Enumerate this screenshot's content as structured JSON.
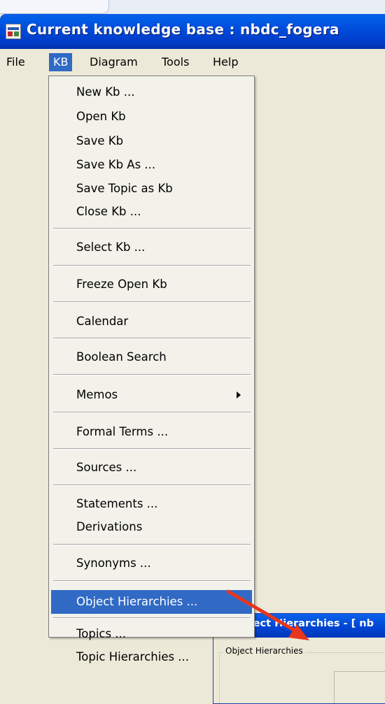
{
  "window": {
    "title": "Current knowledge base : nbdc_fogera"
  },
  "menubar": {
    "items": [
      "File",
      "KB",
      "Diagram",
      "Tools",
      "Help"
    ],
    "active": "KB"
  },
  "kb_menu": {
    "items": [
      {
        "label": "New Kb ...",
        "highlighted": false,
        "submenu": false
      },
      {
        "label": "Open Kb",
        "highlighted": false,
        "submenu": false
      },
      {
        "label": "Save Kb",
        "highlighted": false,
        "submenu": false
      },
      {
        "label": "Save Kb As ...",
        "highlighted": false,
        "submenu": false
      },
      {
        "label": "Save Topic as Kb",
        "highlighted": false,
        "submenu": false
      },
      {
        "label": "Close Kb ...",
        "highlighted": false,
        "submenu": false
      },
      {
        "label": "Select Kb ...",
        "highlighted": false,
        "submenu": false
      },
      {
        "label": "Freeze Open Kb",
        "highlighted": false,
        "submenu": false
      },
      {
        "label": "Calendar",
        "highlighted": false,
        "submenu": false
      },
      {
        "label": "Boolean Search",
        "highlighted": false,
        "submenu": false
      },
      {
        "label": "Memos",
        "highlighted": false,
        "submenu": true
      },
      {
        "label": "Formal Terms ...",
        "highlighted": false,
        "submenu": false
      },
      {
        "label": "Sources ...",
        "highlighted": false,
        "submenu": false
      },
      {
        "label": "Statements ...",
        "highlighted": false,
        "submenu": false
      },
      {
        "label": "Derivations",
        "highlighted": false,
        "submenu": false
      },
      {
        "label": "Synonyms ...",
        "highlighted": false,
        "submenu": false
      },
      {
        "label": "Object Hierarchies ...",
        "highlighted": true,
        "submenu": false
      },
      {
        "label": "Topics ...",
        "highlighted": false,
        "submenu": false
      },
      {
        "label": "Topic Hierarchies ...",
        "highlighted": false,
        "submenu": false
      }
    ]
  },
  "object_hierarchies_window": {
    "title": "Object Hierarchies - [  nb",
    "group_label": "Object Hierarchies"
  },
  "annotation": {
    "arrow_color": "#e8361c"
  },
  "colors": {
    "titlebar": "#0048d8",
    "menu_highlight": "#316ac5",
    "face": "#ece9d8"
  }
}
